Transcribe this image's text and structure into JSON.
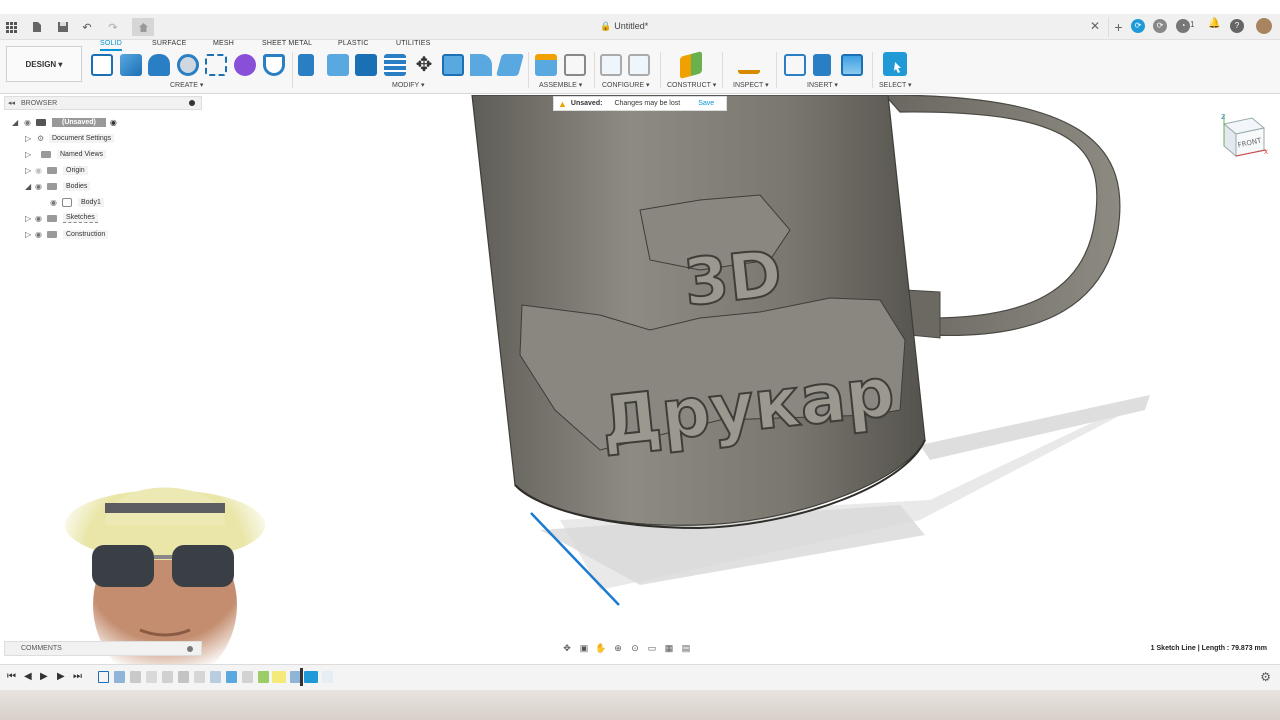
{
  "app": {
    "document_title": "Untitled*",
    "workspace_label": "DESIGN",
    "notification_count": "1"
  },
  "ribbon": {
    "tabs": [
      "SOLID",
      "SURFACE",
      "MESH",
      "SHEET METAL",
      "PLASTIC",
      "UTILITIES"
    ],
    "active_tab": "SOLID",
    "groups": [
      "CREATE",
      "MODIFY",
      "ASSEMBLE",
      "CONFIGURE",
      "CONSTRUCT",
      "INSPECT",
      "INSERT",
      "SELECT"
    ]
  },
  "browser": {
    "title": "BROWSER",
    "items": [
      {
        "label": "(Unsaved)"
      },
      {
        "label": "Document Settings"
      },
      {
        "label": "Named Views"
      },
      {
        "label": "Origin"
      },
      {
        "label": "Bodies"
      },
      {
        "label": "Body1"
      },
      {
        "label": "Sketches"
      },
      {
        "label": "Construction"
      }
    ]
  },
  "notice": {
    "title": "Unsaved:",
    "message": "Changes may be lost",
    "action": "Save"
  },
  "viewcube": {
    "face": "FRONT"
  },
  "model": {
    "text_line1": "3D",
    "text_line2": "Друкар"
  },
  "comments": {
    "title": "COMMENTS"
  },
  "status": {
    "selection": "1 Sketch Line | Length : 79.873 mm"
  },
  "colors": {
    "accent": "#0696d7",
    "mug": "#7d7a72",
    "warning": "#f0a000"
  },
  "icons": [
    "grid-icon",
    "file-icon",
    "save-icon",
    "undo-icon",
    "redo-icon",
    "home-icon",
    "lock-icon",
    "close-icon",
    "plus-icon",
    "help-icon",
    "bell-icon",
    "settings-icon"
  ]
}
